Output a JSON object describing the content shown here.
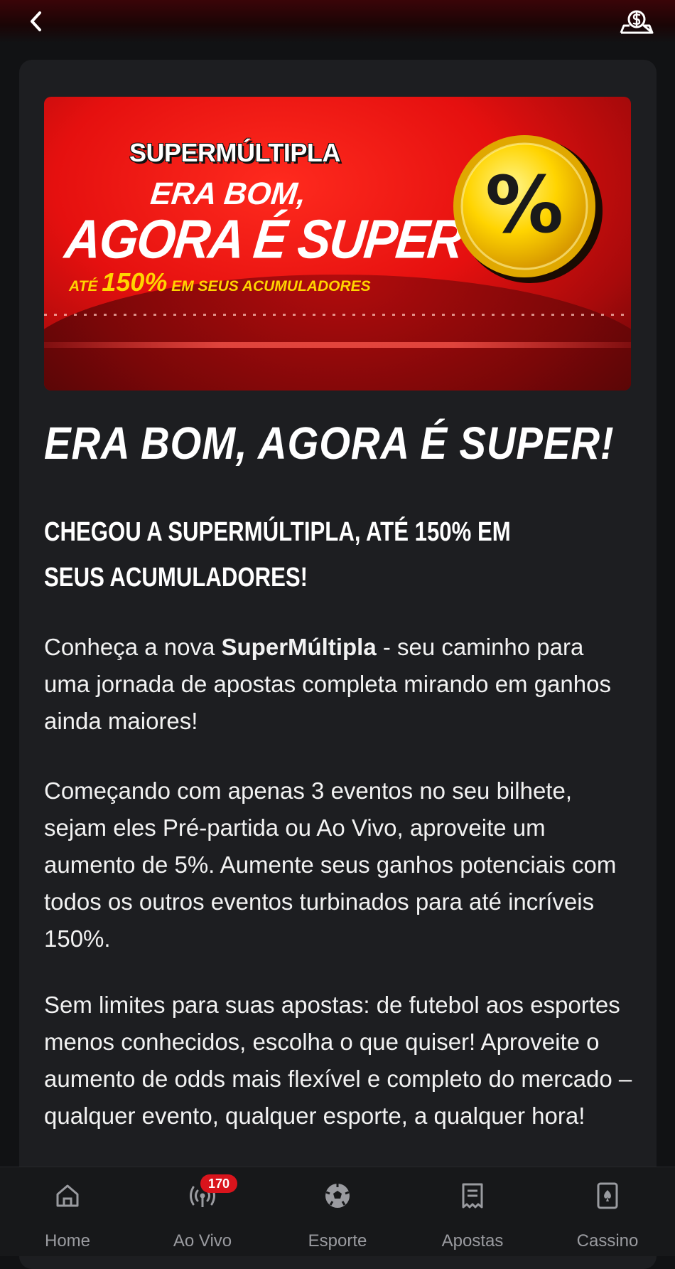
{
  "header": {
    "back_icon": "chevron-left-icon",
    "wallet_icon": "money-bag-icon"
  },
  "banner": {
    "brand": "SUPERMÚLTIPLA",
    "line1": "ERA BOM,",
    "line2": "AGORA É SUPER",
    "line3_prefix": "ATÉ",
    "line3_percent": "150%",
    "line3_suffix": "EM SEUS ACUMULADORES",
    "coin_symbol": "%"
  },
  "article": {
    "title": "ERA BOM, AGORA É SUPER!",
    "subtitle": "CHEGOU A SUPERMÚLTIPLA, ATÉ 150% EM SEUS ACUMULADORES!",
    "p1_before": "Conheça a nova ",
    "p1_bold": "SuperMúltipla",
    "p1_after": " - seu caminho para uma jornada de apostas completa mirando em ganhos ainda maiores!",
    "p2": "Começando com apenas 3 eventos no seu bilhete, sejam eles Pré-partida ou Ao Vivo, aproveite um aumento de 5%. Aumente seus ganhos potenciais com todos os outros eventos turbinados para até incríveis 150%.",
    "p3": "Sem limites para suas apostas: de futebol aos esportes menos conhecidos, escolha o que quiser! Aproveite o aumento de odds mais flexível e completo do mercado – qualquer evento, qualquer esporte, a qualquer hora!"
  },
  "nav": {
    "items": [
      {
        "label": "Home",
        "icon": "home-icon"
      },
      {
        "label": "Ao Vivo",
        "icon": "live-broadcast-icon",
        "badge": "170"
      },
      {
        "label": "Esporte",
        "icon": "soccer-ball-icon"
      },
      {
        "label": "Apostas",
        "icon": "bet-slip-icon"
      },
      {
        "label": "Cassino",
        "icon": "playing-card-icon"
      }
    ]
  },
  "colors": {
    "background": "#111214",
    "card": "#1d1e21",
    "accent_red": "#e5100f",
    "badge_red": "#d9141c",
    "coin_yellow": "#ffd400"
  }
}
